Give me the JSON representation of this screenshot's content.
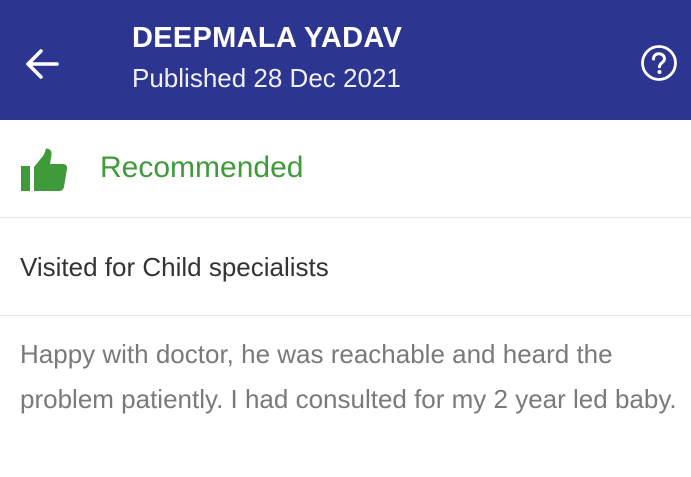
{
  "header": {
    "title": "DEEPMALA YADAV",
    "subtitle": "Published 28 Dec 2021",
    "back_icon": "arrow-left-icon",
    "help_icon": "question-circle-icon",
    "background_color": "#2c3590"
  },
  "recommendation": {
    "icon": "thumbs-up-icon",
    "label": "Recommended",
    "color": "#3f9b3a"
  },
  "visit": {
    "text": "Visited for Child specialists"
  },
  "review": {
    "text": "Happy with doctor, he was reachable and heard the problem patiently. I had consulted for my 2 year led baby."
  }
}
